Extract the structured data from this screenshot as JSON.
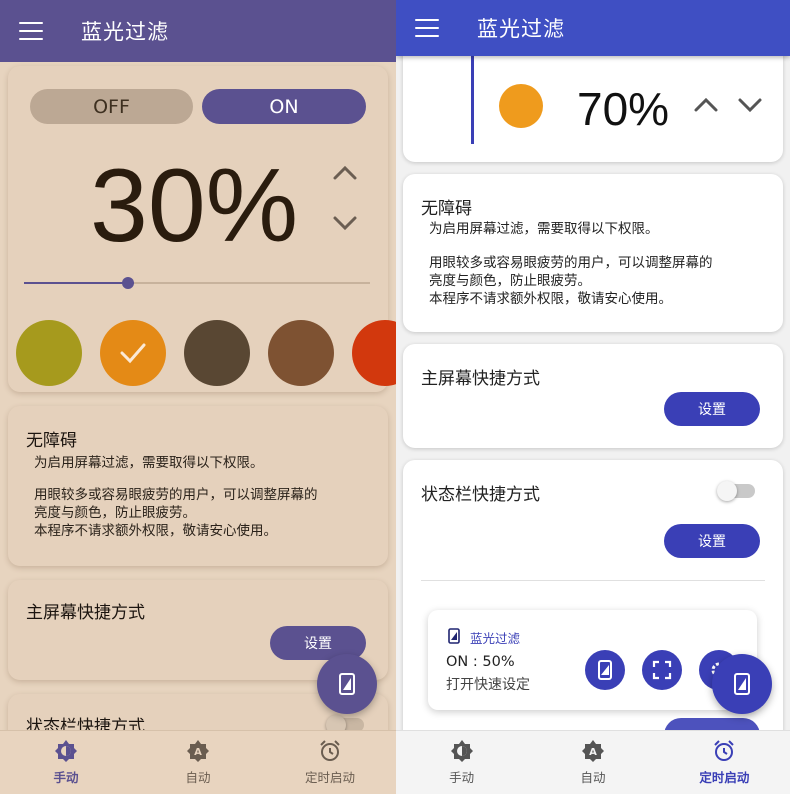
{
  "app_title": "蓝光过滤",
  "left": {
    "toggle": {
      "off_label": "OFF",
      "on_label": "ON",
      "selected": "ON"
    },
    "filter_percent": "30%",
    "slider_value_fraction": 0.3,
    "swatches": [
      {
        "color": "#a69a1d",
        "selected": false
      },
      {
        "color": "#e48a16",
        "selected": true
      },
      {
        "color": "#594733",
        "selected": false
      },
      {
        "color": "#7e5232",
        "selected": false
      },
      {
        "color": "#d2380d",
        "selected": false
      }
    ]
  },
  "right": {
    "filter_percent": "70%",
    "indicator_color": "#ef9b1d",
    "statusbar_switch_on": false,
    "notification": {
      "app_name": "蓝光过滤",
      "status": "ON : 50%",
      "subtitle": "打开快速设定"
    }
  },
  "accessibility": {
    "title": "无障碍",
    "line1": "为启用屏幕过滤，需要取得以下权限。",
    "line2": "用眼较多或容易眼疲劳的用户，可以调整屏幕的",
    "line3": "亮度与颜色，防止眼疲劳。",
    "line4": "本程序不请求额外权限，敬请安心使用。"
  },
  "home_shortcut": {
    "title": "主屏幕快捷方式",
    "button": "设置"
  },
  "statusbar_shortcut": {
    "title": "状态栏快捷方式",
    "button": "设置"
  },
  "bottom_nav": [
    {
      "label": "手动",
      "icon": "brightness-half-icon"
    },
    {
      "label": "自动",
      "icon": "brightness-auto-icon"
    },
    {
      "label": "定时启动",
      "icon": "alarm-clock-icon"
    }
  ],
  "left_active_tab": "手动",
  "right_active_tab": "定时启动",
  "colors": {
    "left_accent": "#5b5190",
    "left_background": "#e7d4bf",
    "right_accent": "#3f4fc3",
    "right_background": "#f1f1f1"
  }
}
